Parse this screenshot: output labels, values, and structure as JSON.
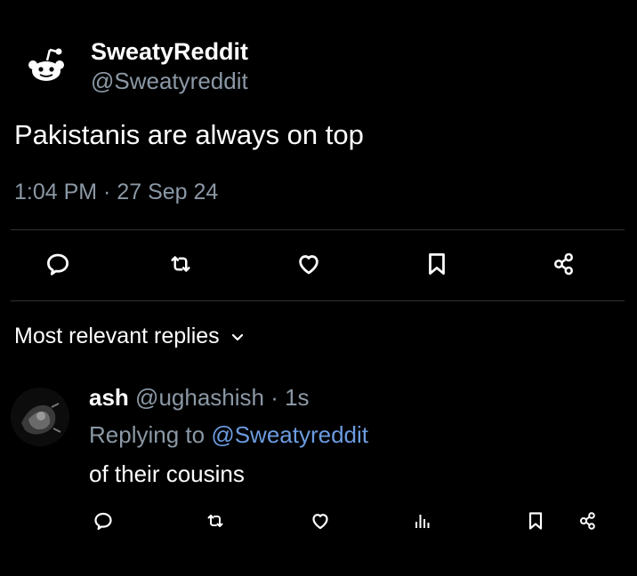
{
  "tweet": {
    "display_name": "SweatyReddit",
    "handle": "@Sweatyreddit",
    "text": "Pakistanis are always on top",
    "timestamp": "1:04 PM · 27 Sep 24",
    "avatar_icon": "reddit-alien-icon",
    "actions": [
      "reply-icon",
      "retweet-icon",
      "like-icon",
      "bookmark-icon",
      "share-icon"
    ]
  },
  "replies": {
    "header": "Most relevant replies",
    "items": [
      {
        "name": "ash",
        "handle_time": "@ughashish · 1s",
        "replying_prefix": "Replying to",
        "replying_mention": "@Sweatyreddit",
        "text": "of their cousins",
        "actions": [
          "reply-icon",
          "retweet-icon",
          "like-icon",
          "views-icon",
          "bookmark-icon",
          "share-icon"
        ]
      }
    ]
  },
  "colors": {
    "background": "#000000",
    "primary_text": "#ffffff",
    "secondary_text": "#8b98a5",
    "mention": "#6b9be0",
    "divider": "#2f3336"
  }
}
